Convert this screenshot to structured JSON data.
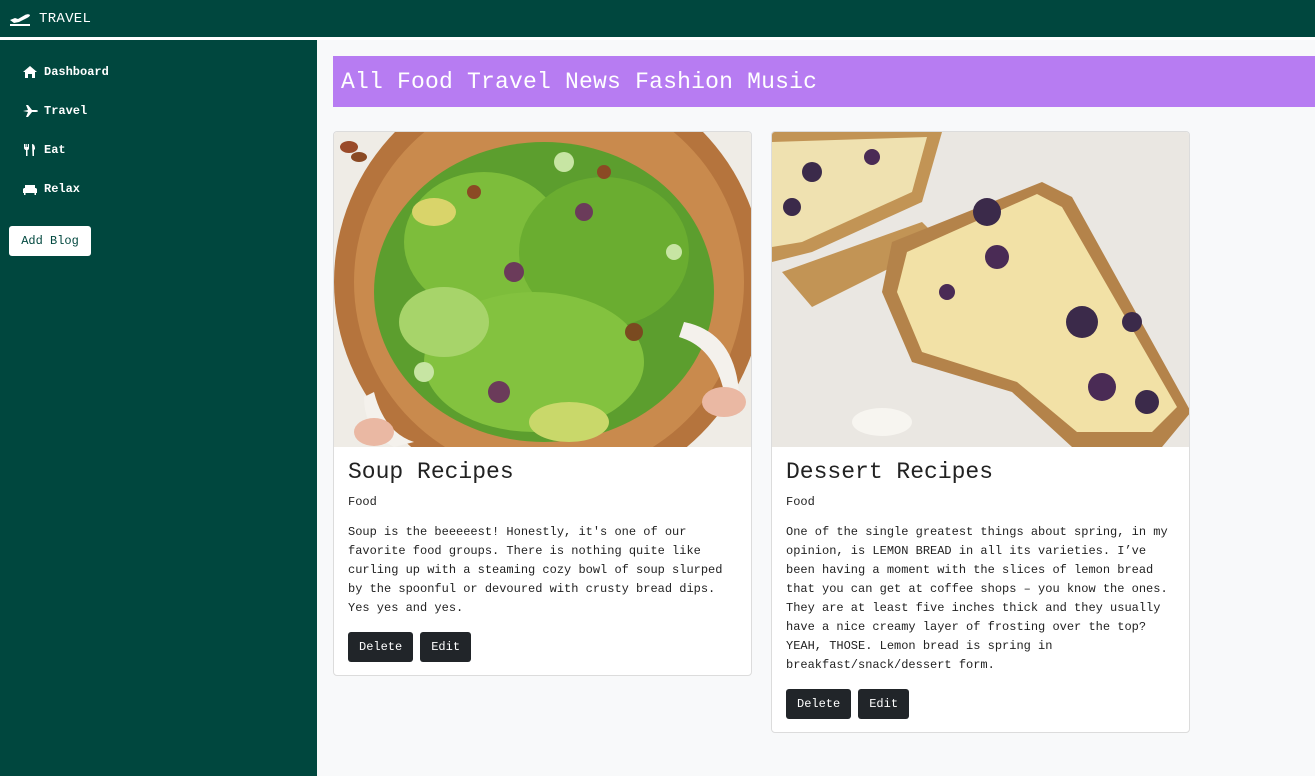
{
  "header": {
    "brand": "TRAVEL",
    "brand_icon": "plane-departure-icon"
  },
  "sidebar": {
    "items": [
      {
        "label": "Dashboard",
        "icon": "home-icon"
      },
      {
        "label": "Travel",
        "icon": "plane-icon"
      },
      {
        "label": "Eat",
        "icon": "utensils-icon"
      },
      {
        "label": "Relax",
        "icon": "couch-icon"
      }
    ],
    "add_button": "Add Blog"
  },
  "categories": [
    "All",
    "Food",
    "Travel",
    "News",
    "Fashion",
    "Music"
  ],
  "colors": {
    "primary": "#00473e",
    "accent": "#b77cf2",
    "button": "#212529"
  },
  "posts": [
    {
      "title": "Soup Recipes",
      "category": "Food",
      "body": "Soup is the beeeeest! Honestly, it's one of our favorite food groups. There is nothing quite like curling up with a steaming cozy bowl of soup slurped by the spoonful or devoured with crusty bread dips. Yes yes and yes.",
      "delete_label": "Delete",
      "edit_label": "Edit"
    },
    {
      "title": "Dessert Recipes",
      "category": "Food",
      "body": "One of the single greatest things about spring, in my opinion, is LEMON BREAD in all its varieties. I’ve been having a moment with the slices of lemon bread that you can get at coffee shops – you know the ones. They are at least five inches thick and they usually have a nice creamy layer of frosting over the top? YEAH, THOSE. Lemon bread is spring in breakfast/snack/dessert form.",
      "delete_label": "Delete",
      "edit_label": "Edit"
    }
  ]
}
